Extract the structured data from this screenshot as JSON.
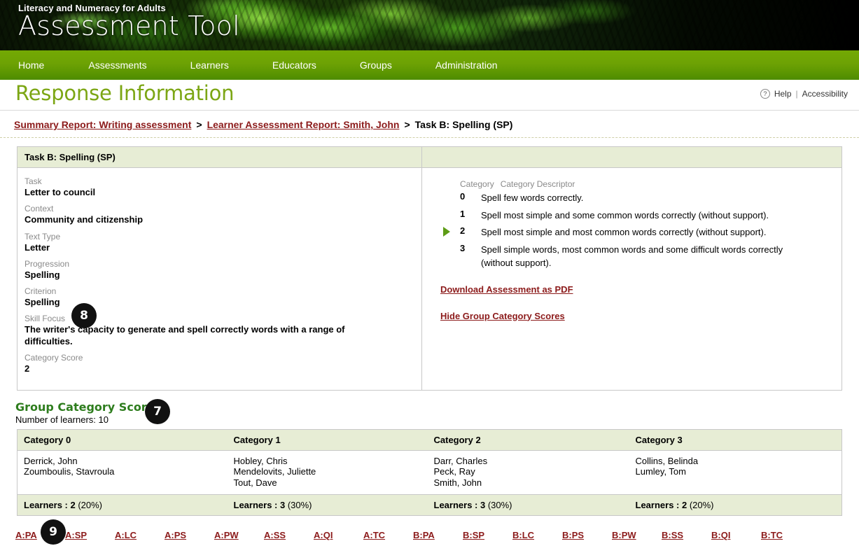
{
  "banner": {
    "subtitle": "Literacy and Numeracy for Adults",
    "title": "Assessment Tool"
  },
  "nav": {
    "items": [
      {
        "label": "Home"
      },
      {
        "label": "Assessments"
      },
      {
        "label": "Learners"
      },
      {
        "label": "Educators"
      },
      {
        "label": "Groups"
      },
      {
        "label": "Administration"
      }
    ]
  },
  "header": {
    "page_title": "Response Information",
    "help_label": "Help",
    "separator": "|",
    "accessibility_label": "Accessibility",
    "help_icon": "question-mark-icon"
  },
  "breadcrumb": {
    "item1": "Summary Report: Writing assessment",
    "sep1": ">",
    "item2": "Learner Assessment Report: Smith, John",
    "sep2": ">",
    "current": "Task B: Spelling (SP)"
  },
  "task_panel": {
    "heading": "Task B: Spelling (SP)",
    "fields": [
      {
        "label": "Task",
        "value": "Letter to council"
      },
      {
        "label": "Context",
        "value": "Community and citizenship"
      },
      {
        "label": "Text Type",
        "value": "Letter"
      },
      {
        "label": "Progression",
        "value": "Spelling"
      },
      {
        "label": "Criterion",
        "value": "Spelling"
      },
      {
        "label": "Skill Focus",
        "value": "The writer's capacity to generate and spell correctly words with a range of difficulties."
      },
      {
        "label": "Category Score",
        "value": "2"
      }
    ]
  },
  "descriptor_panel": {
    "col_category": "Category",
    "col_descriptor": "Category Descriptor",
    "selected_category": "2",
    "rows": [
      {
        "category": "0",
        "descriptor": "Spell few words correctly.",
        "selected": false
      },
      {
        "category": "1",
        "descriptor": "Spell most simple and some common words correctly (without support).",
        "selected": false
      },
      {
        "category": "2",
        "descriptor": "Spell most simple and most common words correctly (without support).",
        "selected": true
      },
      {
        "category": "3",
        "descriptor": "Spell simple words, most common words and some difficult words correctly (without support).",
        "selected": false
      }
    ],
    "download_link": "Download Assessment as PDF",
    "hide_link": "Hide Group Category Scores"
  },
  "group_scores": {
    "title": "Group Category Scores",
    "learner_count_text": "Number of learners: 10",
    "columns": [
      {
        "header": "Category 0",
        "learners": [
          "Derrick, John",
          "Zoumboulis, Stavroula"
        ],
        "total": "Learners : 2 (20%)",
        "total_bold": "Learners : 2",
        "total_pct": " (20%)"
      },
      {
        "header": "Category 1",
        "learners": [
          "Hobley, Chris",
          "Mendelovits, Juliette",
          "Tout, Dave"
        ],
        "total": "Learners : 3 (30%)",
        "total_bold": "Learners : 3",
        "total_pct": " (30%)"
      },
      {
        "header": "Category 2",
        "learners": [
          "Darr, Charles",
          "Peck, Ray",
          "Smith, John"
        ],
        "total": "Learners : 3 (30%)",
        "total_bold": "Learners : 3",
        "total_pct": " (30%)"
      },
      {
        "header": "Category 3",
        "learners": [
          "Collins, Belinda",
          "Lumley, Tom"
        ],
        "total": "Learners : 2 (20%)",
        "total_bold": "Learners : 2",
        "total_pct": " (20%)"
      }
    ]
  },
  "code_links": [
    "A:PA",
    "A:SP",
    "A:LC",
    "A:PS",
    "A:PW",
    "A:SS",
    "A:QI",
    "A:TC",
    "B:PA",
    "B:SP",
    "B:LC",
    "B:PS",
    "B:PW",
    "B:SS",
    "B:QI",
    "B:TC"
  ],
  "callouts": [
    {
      "number": "8"
    },
    {
      "number": "7"
    },
    {
      "number": "9"
    }
  ],
  "colors": {
    "nav_green": "#6da204",
    "title_green": "#7ca614",
    "link_red": "#8c1b1b",
    "panel_header_bg": "#e7edd5",
    "gcs_title_green": "#2e7d1e",
    "marker_green": "#5d9c15"
  }
}
